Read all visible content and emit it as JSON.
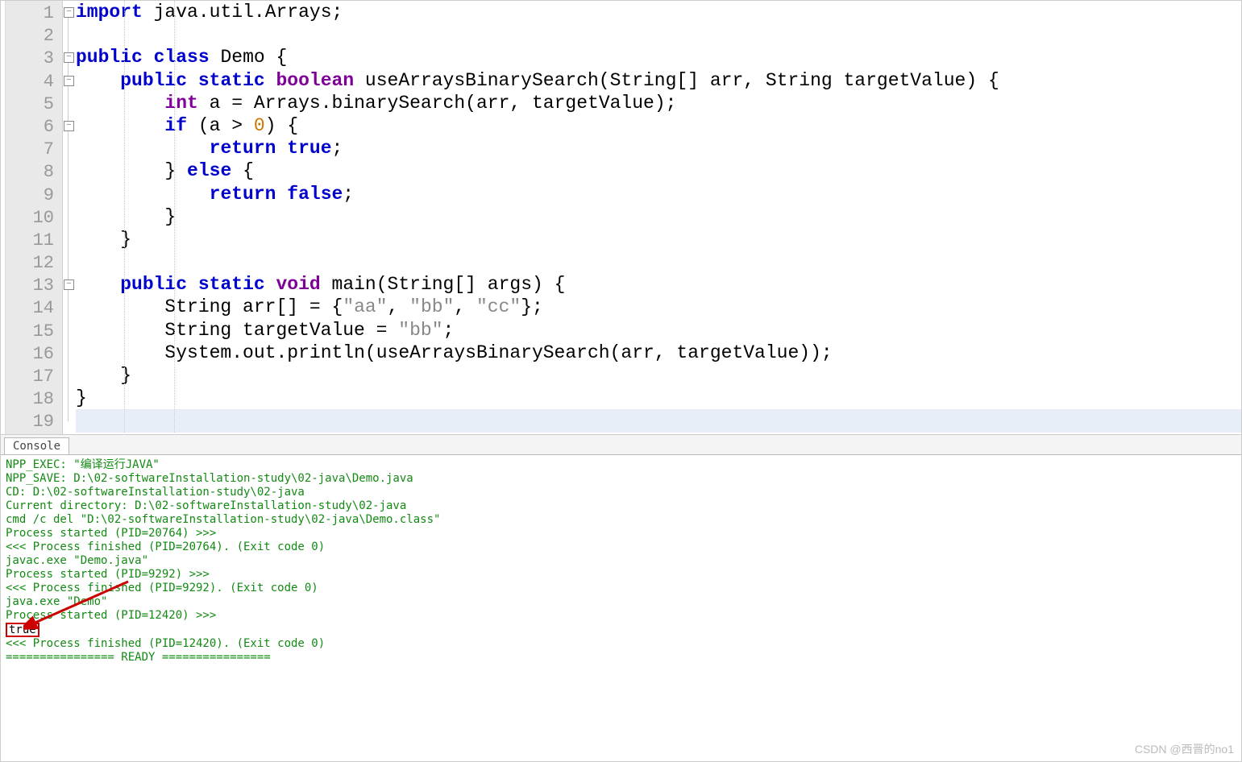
{
  "editor": {
    "line_count": 19,
    "current_line": 19,
    "fold_markers": [
      1,
      3,
      4,
      6,
      13
    ],
    "tokens": [
      [
        {
          "c": "kw2",
          "t": "import"
        },
        {
          "c": "id",
          "t": " java"
        },
        {
          "c": "pun",
          "t": "."
        },
        {
          "c": "id",
          "t": "util"
        },
        {
          "c": "pun",
          "t": "."
        },
        {
          "c": "id",
          "t": "Arrays"
        },
        {
          "c": "pun",
          "t": ";"
        }
      ],
      [],
      [
        {
          "c": "kw2",
          "t": "public"
        },
        {
          "c": "id",
          "t": " "
        },
        {
          "c": "kw2",
          "t": "class"
        },
        {
          "c": "id",
          "t": " Demo "
        },
        {
          "c": "pun",
          "t": "{"
        }
      ],
      [
        {
          "c": "id",
          "t": "    "
        },
        {
          "c": "kw2",
          "t": "public"
        },
        {
          "c": "id",
          "t": " "
        },
        {
          "c": "kw2",
          "t": "static"
        },
        {
          "c": "id",
          "t": " "
        },
        {
          "c": "kw",
          "t": "boolean"
        },
        {
          "c": "id",
          "t": " useArraysBinarySearch"
        },
        {
          "c": "pun",
          "t": "("
        },
        {
          "c": "id",
          "t": "String"
        },
        {
          "c": "pun",
          "t": "[]"
        },
        {
          "c": "id",
          "t": " arr"
        },
        {
          "c": "pun",
          "t": ","
        },
        {
          "c": "id",
          "t": " String targetValue"
        },
        {
          "c": "pun",
          "t": ")"
        },
        {
          "c": "id",
          "t": " "
        },
        {
          "c": "pun",
          "t": "{"
        }
      ],
      [
        {
          "c": "id",
          "t": "        "
        },
        {
          "c": "kw",
          "t": "int"
        },
        {
          "c": "id",
          "t": " a "
        },
        {
          "c": "pun",
          "t": "="
        },
        {
          "c": "id",
          "t": " Arrays"
        },
        {
          "c": "pun",
          "t": "."
        },
        {
          "c": "id",
          "t": "binarySearch"
        },
        {
          "c": "pun",
          "t": "("
        },
        {
          "c": "id",
          "t": "arr"
        },
        {
          "c": "pun",
          "t": ","
        },
        {
          "c": "id",
          "t": " targetValue"
        },
        {
          "c": "pun",
          "t": ");"
        }
      ],
      [
        {
          "c": "id",
          "t": "        "
        },
        {
          "c": "kw2",
          "t": "if"
        },
        {
          "c": "id",
          "t": " "
        },
        {
          "c": "pun",
          "t": "("
        },
        {
          "c": "id",
          "t": "a "
        },
        {
          "c": "pun",
          "t": ">"
        },
        {
          "c": "id",
          "t": " "
        },
        {
          "c": "num",
          "t": "0"
        },
        {
          "c": "pun",
          "t": ")"
        },
        {
          "c": "id",
          "t": " "
        },
        {
          "c": "pun",
          "t": "{"
        }
      ],
      [
        {
          "c": "id",
          "t": "            "
        },
        {
          "c": "kw2",
          "t": "return"
        },
        {
          "c": "id",
          "t": " "
        },
        {
          "c": "kw2",
          "t": "true"
        },
        {
          "c": "pun",
          "t": ";"
        }
      ],
      [
        {
          "c": "id",
          "t": "        "
        },
        {
          "c": "pun",
          "t": "}"
        },
        {
          "c": "id",
          "t": " "
        },
        {
          "c": "kw2",
          "t": "else"
        },
        {
          "c": "id",
          "t": " "
        },
        {
          "c": "pun",
          "t": "{"
        }
      ],
      [
        {
          "c": "id",
          "t": "            "
        },
        {
          "c": "kw2",
          "t": "return"
        },
        {
          "c": "id",
          "t": " "
        },
        {
          "c": "kw2",
          "t": "false"
        },
        {
          "c": "pun",
          "t": ";"
        }
      ],
      [
        {
          "c": "id",
          "t": "        "
        },
        {
          "c": "pun",
          "t": "}"
        }
      ],
      [
        {
          "c": "id",
          "t": "    "
        },
        {
          "c": "pun",
          "t": "}"
        }
      ],
      [],
      [
        {
          "c": "id",
          "t": "    "
        },
        {
          "c": "kw2",
          "t": "public"
        },
        {
          "c": "id",
          "t": " "
        },
        {
          "c": "kw2",
          "t": "static"
        },
        {
          "c": "id",
          "t": " "
        },
        {
          "c": "kw",
          "t": "void"
        },
        {
          "c": "id",
          "t": " main"
        },
        {
          "c": "pun",
          "t": "("
        },
        {
          "c": "id",
          "t": "String"
        },
        {
          "c": "pun",
          "t": "[]"
        },
        {
          "c": "id",
          "t": " args"
        },
        {
          "c": "pun",
          "t": ")"
        },
        {
          "c": "id",
          "t": " "
        },
        {
          "c": "pun",
          "t": "{"
        }
      ],
      [
        {
          "c": "id",
          "t": "        String arr"
        },
        {
          "c": "pun",
          "t": "[]"
        },
        {
          "c": "id",
          "t": " "
        },
        {
          "c": "pun",
          "t": "="
        },
        {
          "c": "id",
          "t": " "
        },
        {
          "c": "pun",
          "t": "{"
        },
        {
          "c": "str",
          "t": "\"aa\""
        },
        {
          "c": "pun",
          "t": ","
        },
        {
          "c": "id",
          "t": " "
        },
        {
          "c": "str",
          "t": "\"bb\""
        },
        {
          "c": "pun",
          "t": ","
        },
        {
          "c": "id",
          "t": " "
        },
        {
          "c": "str",
          "t": "\"cc\""
        },
        {
          "c": "pun",
          "t": "};"
        }
      ],
      [
        {
          "c": "id",
          "t": "        String targetValue "
        },
        {
          "c": "pun",
          "t": "="
        },
        {
          "c": "id",
          "t": " "
        },
        {
          "c": "str",
          "t": "\"bb\""
        },
        {
          "c": "pun",
          "t": ";"
        }
      ],
      [
        {
          "c": "id",
          "t": "        System"
        },
        {
          "c": "pun",
          "t": "."
        },
        {
          "c": "id",
          "t": "out"
        },
        {
          "c": "pun",
          "t": "."
        },
        {
          "c": "id",
          "t": "println"
        },
        {
          "c": "pun",
          "t": "("
        },
        {
          "c": "id",
          "t": "useArraysBinarySearch"
        },
        {
          "c": "pun",
          "t": "("
        },
        {
          "c": "id",
          "t": "arr"
        },
        {
          "c": "pun",
          "t": ","
        },
        {
          "c": "id",
          "t": " targetValue"
        },
        {
          "c": "pun",
          "t": "));"
        }
      ],
      [
        {
          "c": "id",
          "t": "    "
        },
        {
          "c": "pun",
          "t": "}"
        }
      ],
      [
        {
          "c": "pun",
          "t": "}"
        }
      ],
      []
    ]
  },
  "console": {
    "tab_label": "Console",
    "lines": [
      "NPP_EXEC: \"编译运行JAVA\"",
      "NPP_SAVE: D:\\02-softwareInstallation-study\\02-java\\Demo.java",
      "CD: D:\\02-softwareInstallation-study\\02-java",
      "Current directory: D:\\02-softwareInstallation-study\\02-java",
      "cmd /c del \"D:\\02-softwareInstallation-study\\02-java\\Demo.class\"",
      "Process started (PID=20764) >>>",
      "<<< Process finished (PID=20764). (Exit code 0)",
      "javac.exe \"Demo.java\"",
      "Process started (PID=9292) >>>",
      "<<< Process finished (PID=9292). (Exit code 0)",
      "java.exe \"Demo\"",
      "Process started (PID=12420) >>>"
    ],
    "output_value": "true",
    "tail_lines": [
      "<<< Process finished (PID=12420). (Exit code 0)",
      "================ READY ================"
    ]
  },
  "watermark": "CSDN @西晋的no1"
}
